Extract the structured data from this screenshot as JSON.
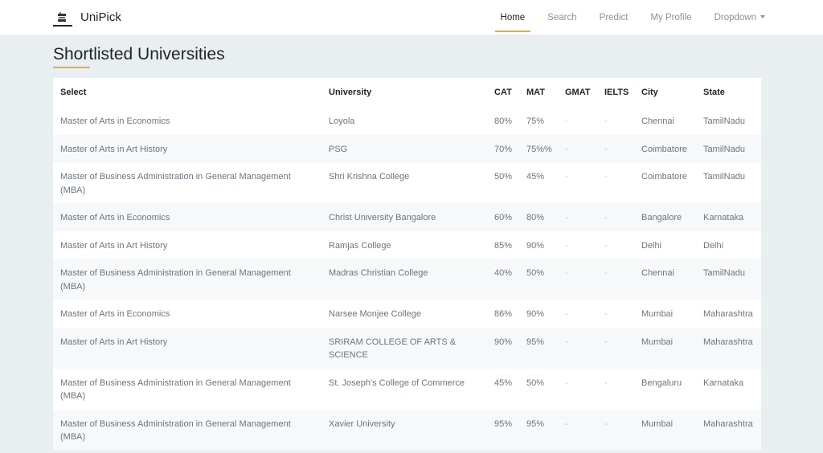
{
  "brand": {
    "name": "UniPick",
    "icon": "graduation-cap-icon"
  },
  "nav": [
    {
      "label": "Home",
      "active": true
    },
    {
      "label": "Search",
      "active": false
    },
    {
      "label": "Predict",
      "active": false
    },
    {
      "label": "My Profile",
      "active": false
    },
    {
      "label": "Dropdown",
      "active": false
    }
  ],
  "page": {
    "title": "Shortlisted Universities"
  },
  "colors": {
    "accent": "#f0a92a",
    "background": "#e9eef0"
  },
  "table": {
    "headers": [
      "Select",
      "University",
      "CAT",
      "MAT",
      "GMAT",
      "IELTS",
      "City",
      "State"
    ],
    "rows": [
      [
        "Master of Arts in Economics",
        "Loyola",
        "80%",
        "75%",
        "-",
        "-",
        "Chennai",
        "TamilNadu"
      ],
      [
        "Master of Arts in Art History",
        "PSG",
        "70%",
        "75%%",
        "-",
        "-",
        "Coimbatore",
        "TamilNadu"
      ],
      [
        "Master of Business Administration in General Management (MBA)",
        "Shri Krishna College",
        "50%",
        "45%",
        "-",
        "-",
        "Coimbatore",
        "TamilNadu"
      ],
      [
        "Master of Arts in Economics",
        "Christ University Bangalore",
        "60%",
        "80%",
        "-",
        "-",
        "Bangalore",
        "Karnataka"
      ],
      [
        "Master of Arts in Art History",
        "Ramjas College",
        "85%",
        "90%",
        "-",
        "-",
        "Delhi",
        "Delhi"
      ],
      [
        "Master of Business Administration in General Management (MBA)",
        "Madras Christian College",
        "40%",
        "50%",
        "-",
        "-",
        "Chennai",
        "TamilNadu"
      ],
      [
        "Master of Arts in Economics",
        "Narsee Monjee College",
        "86%",
        "90%",
        "-",
        "-",
        "Mumbai",
        "Maharashtra"
      ],
      [
        "Master of Arts in Art History",
        "SRIRAM COLLEGE OF ARTS & SCIENCE",
        "90%",
        "95%",
        "-",
        "-",
        "Mumbai",
        "Maharashtra"
      ],
      [
        "Master of Business Administration in General Management (MBA)",
        "St. Joseph's College of Commerce",
        "45%",
        "50%",
        "-",
        "-",
        "Bengaluru",
        "Karnataka"
      ],
      [
        "Master of Business Administration in General Management (MBA)",
        "Xavier University",
        "95%",
        "95%",
        "-",
        "-",
        "Mumbai",
        "Maharashtra"
      ]
    ]
  }
}
